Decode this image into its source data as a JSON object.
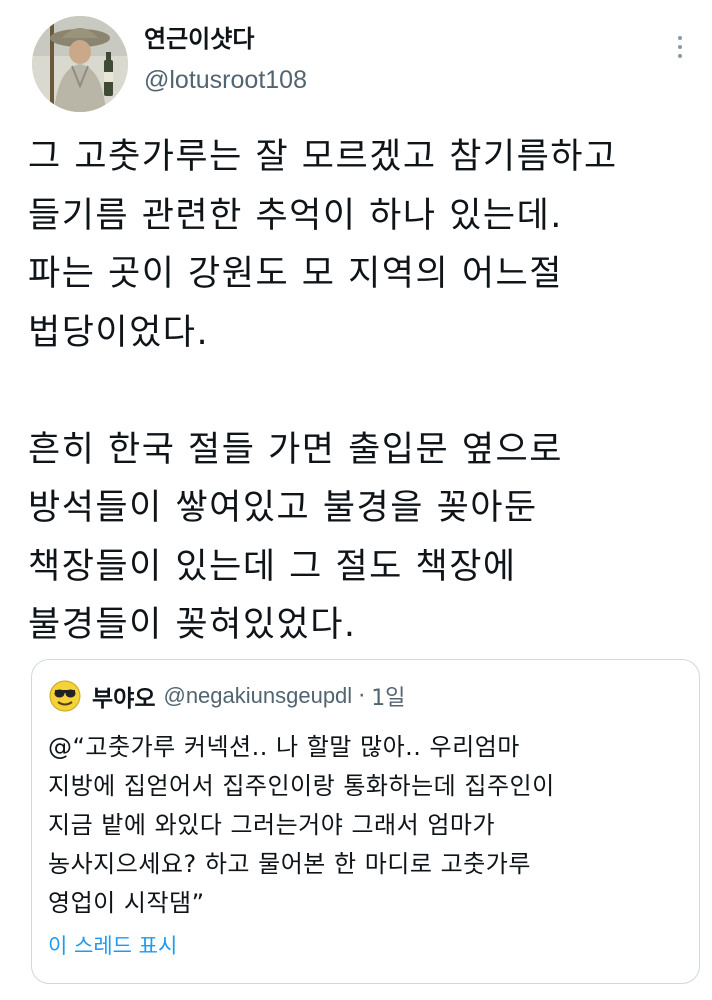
{
  "tweet": {
    "display_name": "연근이샷다",
    "handle": "@lotusroot108",
    "avatar_icon": "monk-avatar-icon",
    "more_icon": "more-options-icon",
    "body": "그 고춧가루는 잘 모르겠고 참기름하고\n들기름 관련한 추억이 하나 있는데.\n파는 곳이 강원도 모 지역의 어느절\n법당이었다.\n\n흔히 한국 절들 가면 출입문 옆으로\n방석들이 쌓여있고 불경을 꽂아둔\n책장들이 있는데 그 절도 책장에\n불경들이 꽂혀있었다."
  },
  "quoted_tweet": {
    "display_name": "부야오",
    "handle": "@negakiunsgeupdl",
    "separator": "·",
    "time": "1일",
    "avatar_icon": "sunglasses-emoji-avatar-icon",
    "body": "@“고춧가루 커넥션.. 나 할말 많아.. 우리엄마\n지방에 집얻어서 집주인이랑 통화하는데 집주인이\n지금 밭에 와있다 그러는거야 그래서 엄마가\n농사지으세요? 하고 물어본 한 마디로 고춧가루\n영업이 시작댐”",
    "show_thread": "이 스레드 표시"
  },
  "colors": {
    "text_primary": "#0f1419",
    "text_secondary": "#536471",
    "link": "#1d9bf0",
    "border": "#cfd9de"
  }
}
